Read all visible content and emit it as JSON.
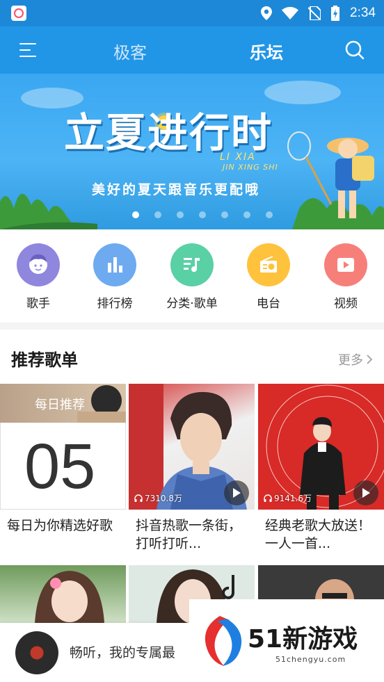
{
  "status_bar": {
    "time": "2:34"
  },
  "header": {
    "tabs": [
      {
        "label": "极客",
        "active": false
      },
      {
        "label": "乐坛",
        "active": true
      }
    ]
  },
  "banner": {
    "title": "立夏进行时",
    "pinyin_line1": "LI XIA",
    "pinyin_line2": "JIN XING SHI",
    "subtitle": "美好的夏天跟音乐更配哦",
    "page_count": 7,
    "active_page": 1
  },
  "quick_nav": [
    {
      "label": "歌手",
      "icon": "singer-icon",
      "color": "#8f86dd"
    },
    {
      "label": "排行榜",
      "icon": "chart-bars-icon",
      "color": "#6eaaf0"
    },
    {
      "label": "分类·歌单",
      "icon": "music-list-icon",
      "color": "#5ad0a5"
    },
    {
      "label": "电台",
      "icon": "radio-icon",
      "color": "#ffc23d"
    },
    {
      "label": "视频",
      "icon": "video-play-icon",
      "color": "#f77f7a"
    }
  ],
  "recommend": {
    "title": "推荐歌单",
    "more_label": "更多",
    "playlists": [
      {
        "badge": "每日推荐",
        "date": "05",
        "title": "每日为你精选好歌"
      },
      {
        "play_count": "7310.8万",
        "title": "抖音热歌一条街，打听打听..."
      },
      {
        "play_count": "9141.6万",
        "title": "经典老歌大放送！一人一首..."
      }
    ]
  },
  "player": {
    "text": "畅听，我的专属最"
  },
  "watermark": {
    "brand": "51新游戏",
    "url": "51chengyu.com"
  },
  "colors": {
    "primary": "#2196e6",
    "status_bar": "#1e88d8"
  }
}
